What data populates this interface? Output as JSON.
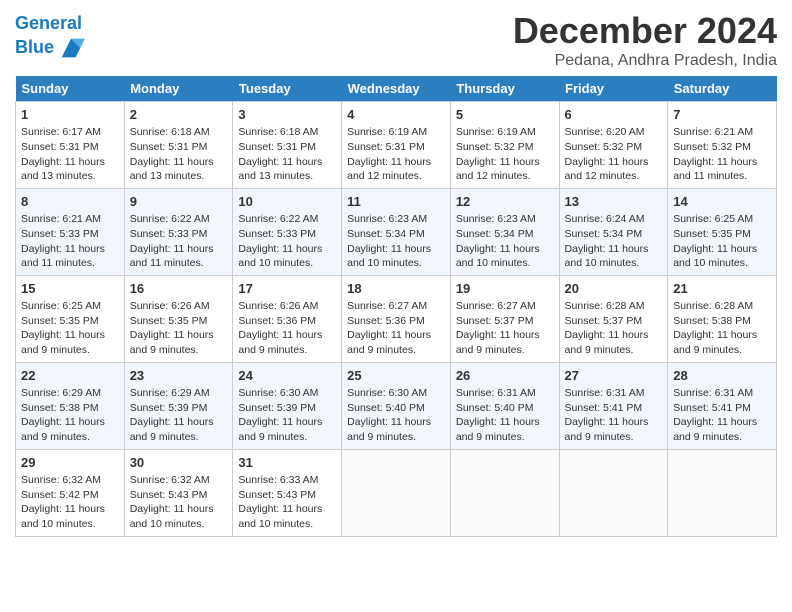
{
  "header": {
    "logo_line1": "General",
    "logo_line2": "Blue",
    "title": "December 2024",
    "subtitle": "Pedana, Andhra Pradesh, India"
  },
  "days_of_week": [
    "Sunday",
    "Monday",
    "Tuesday",
    "Wednesday",
    "Thursday",
    "Friday",
    "Saturday"
  ],
  "weeks": [
    [
      {
        "day": "1",
        "lines": [
          "Sunrise: 6:17 AM",
          "Sunset: 5:31 PM",
          "Daylight: 11 hours",
          "and 13 minutes."
        ]
      },
      {
        "day": "2",
        "lines": [
          "Sunrise: 6:18 AM",
          "Sunset: 5:31 PM",
          "Daylight: 11 hours",
          "and 13 minutes."
        ]
      },
      {
        "day": "3",
        "lines": [
          "Sunrise: 6:18 AM",
          "Sunset: 5:31 PM",
          "Daylight: 11 hours",
          "and 13 minutes."
        ]
      },
      {
        "day": "4",
        "lines": [
          "Sunrise: 6:19 AM",
          "Sunset: 5:31 PM",
          "Daylight: 11 hours",
          "and 12 minutes."
        ]
      },
      {
        "day": "5",
        "lines": [
          "Sunrise: 6:19 AM",
          "Sunset: 5:32 PM",
          "Daylight: 11 hours",
          "and 12 minutes."
        ]
      },
      {
        "day": "6",
        "lines": [
          "Sunrise: 6:20 AM",
          "Sunset: 5:32 PM",
          "Daylight: 11 hours",
          "and 12 minutes."
        ]
      },
      {
        "day": "7",
        "lines": [
          "Sunrise: 6:21 AM",
          "Sunset: 5:32 PM",
          "Daylight: 11 hours",
          "and 11 minutes."
        ]
      }
    ],
    [
      {
        "day": "8",
        "lines": [
          "Sunrise: 6:21 AM",
          "Sunset: 5:33 PM",
          "Daylight: 11 hours",
          "and 11 minutes."
        ]
      },
      {
        "day": "9",
        "lines": [
          "Sunrise: 6:22 AM",
          "Sunset: 5:33 PM",
          "Daylight: 11 hours",
          "and 11 minutes."
        ]
      },
      {
        "day": "10",
        "lines": [
          "Sunrise: 6:22 AM",
          "Sunset: 5:33 PM",
          "Daylight: 11 hours",
          "and 10 minutes."
        ]
      },
      {
        "day": "11",
        "lines": [
          "Sunrise: 6:23 AM",
          "Sunset: 5:34 PM",
          "Daylight: 11 hours",
          "and 10 minutes."
        ]
      },
      {
        "day": "12",
        "lines": [
          "Sunrise: 6:23 AM",
          "Sunset: 5:34 PM",
          "Daylight: 11 hours",
          "and 10 minutes."
        ]
      },
      {
        "day": "13",
        "lines": [
          "Sunrise: 6:24 AM",
          "Sunset: 5:34 PM",
          "Daylight: 11 hours",
          "and 10 minutes."
        ]
      },
      {
        "day": "14",
        "lines": [
          "Sunrise: 6:25 AM",
          "Sunset: 5:35 PM",
          "Daylight: 11 hours",
          "and 10 minutes."
        ]
      }
    ],
    [
      {
        "day": "15",
        "lines": [
          "Sunrise: 6:25 AM",
          "Sunset: 5:35 PM",
          "Daylight: 11 hours",
          "and 9 minutes."
        ]
      },
      {
        "day": "16",
        "lines": [
          "Sunrise: 6:26 AM",
          "Sunset: 5:35 PM",
          "Daylight: 11 hours",
          "and 9 minutes."
        ]
      },
      {
        "day": "17",
        "lines": [
          "Sunrise: 6:26 AM",
          "Sunset: 5:36 PM",
          "Daylight: 11 hours",
          "and 9 minutes."
        ]
      },
      {
        "day": "18",
        "lines": [
          "Sunrise: 6:27 AM",
          "Sunset: 5:36 PM",
          "Daylight: 11 hours",
          "and 9 minutes."
        ]
      },
      {
        "day": "19",
        "lines": [
          "Sunrise: 6:27 AM",
          "Sunset: 5:37 PM",
          "Daylight: 11 hours",
          "and 9 minutes."
        ]
      },
      {
        "day": "20",
        "lines": [
          "Sunrise: 6:28 AM",
          "Sunset: 5:37 PM",
          "Daylight: 11 hours",
          "and 9 minutes."
        ]
      },
      {
        "day": "21",
        "lines": [
          "Sunrise: 6:28 AM",
          "Sunset: 5:38 PM",
          "Daylight: 11 hours",
          "and 9 minutes."
        ]
      }
    ],
    [
      {
        "day": "22",
        "lines": [
          "Sunrise: 6:29 AM",
          "Sunset: 5:38 PM",
          "Daylight: 11 hours",
          "and 9 minutes."
        ]
      },
      {
        "day": "23",
        "lines": [
          "Sunrise: 6:29 AM",
          "Sunset: 5:39 PM",
          "Daylight: 11 hours",
          "and 9 minutes."
        ]
      },
      {
        "day": "24",
        "lines": [
          "Sunrise: 6:30 AM",
          "Sunset: 5:39 PM",
          "Daylight: 11 hours",
          "and 9 minutes."
        ]
      },
      {
        "day": "25",
        "lines": [
          "Sunrise: 6:30 AM",
          "Sunset: 5:40 PM",
          "Daylight: 11 hours",
          "and 9 minutes."
        ]
      },
      {
        "day": "26",
        "lines": [
          "Sunrise: 6:31 AM",
          "Sunset: 5:40 PM",
          "Daylight: 11 hours",
          "and 9 minutes."
        ]
      },
      {
        "day": "27",
        "lines": [
          "Sunrise: 6:31 AM",
          "Sunset: 5:41 PM",
          "Daylight: 11 hours",
          "and 9 minutes."
        ]
      },
      {
        "day": "28",
        "lines": [
          "Sunrise: 6:31 AM",
          "Sunset: 5:41 PM",
          "Daylight: 11 hours",
          "and 9 minutes."
        ]
      }
    ],
    [
      {
        "day": "29",
        "lines": [
          "Sunrise: 6:32 AM",
          "Sunset: 5:42 PM",
          "Daylight: 11 hours",
          "and 10 minutes."
        ]
      },
      {
        "day": "30",
        "lines": [
          "Sunrise: 6:32 AM",
          "Sunset: 5:43 PM",
          "Daylight: 11 hours",
          "and 10 minutes."
        ]
      },
      {
        "day": "31",
        "lines": [
          "Sunrise: 6:33 AM",
          "Sunset: 5:43 PM",
          "Daylight: 11 hours",
          "and 10 minutes."
        ]
      },
      null,
      null,
      null,
      null
    ]
  ]
}
